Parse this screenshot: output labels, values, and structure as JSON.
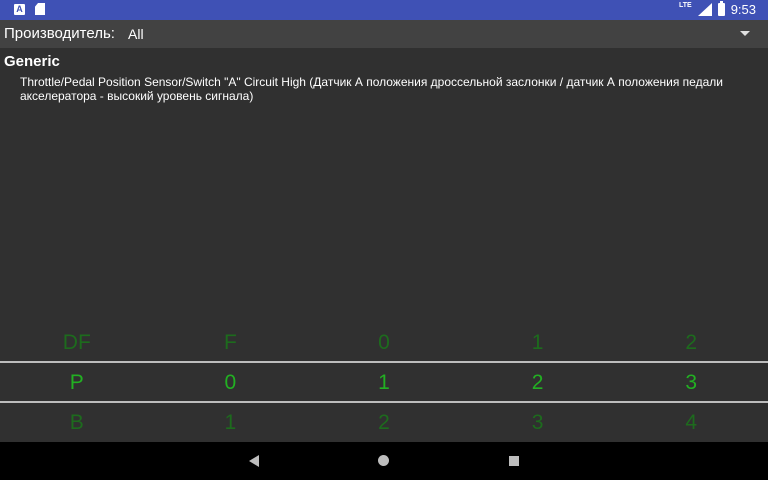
{
  "status_bar": {
    "left_icons": [
      "a-notification-icon",
      "sd-card-icon"
    ],
    "network_label": "LTE",
    "time": "9:53"
  },
  "toolbar": {
    "manufacturer_label": "Производитель:",
    "manufacturer_value": "All"
  },
  "content": {
    "section_title": "Generic",
    "code_description": "Throttle/Pedal Position Sensor/Switch \"A\" Circuit High (Датчик А положения дроссельной заслонки / датчик А положения педали акселератора - высокий уровень сигнала)"
  },
  "picker": {
    "previous_row": [
      "DF",
      "F",
      "0",
      "1",
      "2"
    ],
    "current_row": [
      "P",
      "0",
      "1",
      "2",
      "3"
    ],
    "next_row": [
      "B",
      "1",
      "2",
      "3",
      "4"
    ]
  },
  "colors": {
    "status_bar": "#3f51b5",
    "background": "#303030",
    "selected_digit": "#22b022",
    "faded_digit": "#1d6b1d"
  }
}
